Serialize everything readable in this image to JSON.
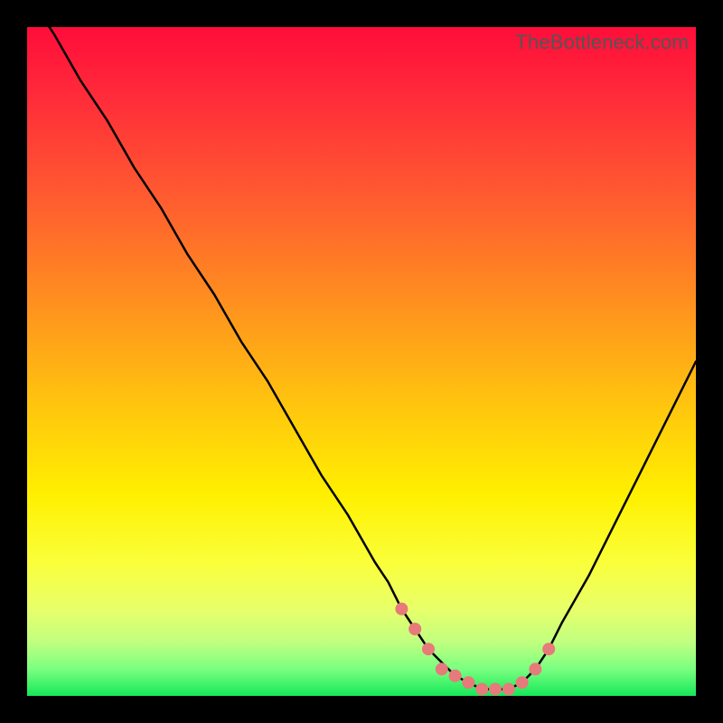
{
  "watermark": "TheBottleneck.com",
  "chart_data": {
    "type": "line",
    "title": "",
    "xlabel": "",
    "ylabel": "",
    "xlim": [
      0,
      100
    ],
    "ylim": [
      0,
      100
    ],
    "series": [
      {
        "name": "bottleneck-curve",
        "x": [
          0,
          4,
          8,
          12,
          16,
          20,
          24,
          28,
          32,
          36,
          40,
          44,
          48,
          52,
          54,
          56,
          58,
          60,
          62,
          64,
          66,
          68,
          70,
          72,
          74,
          76,
          78,
          80,
          84,
          88,
          92,
          96,
          100
        ],
        "values": [
          105,
          99,
          92,
          86,
          79,
          73,
          66,
          60,
          53,
          47,
          40,
          33,
          27,
          20,
          17,
          13,
          10,
          7,
          5,
          3,
          2,
          1,
          1,
          1,
          2,
          4,
          7,
          11,
          18,
          26,
          34,
          42,
          50
        ]
      }
    ],
    "highlight": {
      "name": "highlight-dots",
      "color": "#e77a7a",
      "x": [
        56,
        58,
        60,
        62,
        64,
        66,
        68,
        70,
        72,
        74,
        76,
        78
      ],
      "values": [
        13,
        10,
        7,
        4,
        3,
        2,
        1,
        1,
        1,
        2,
        4,
        7
      ]
    }
  }
}
